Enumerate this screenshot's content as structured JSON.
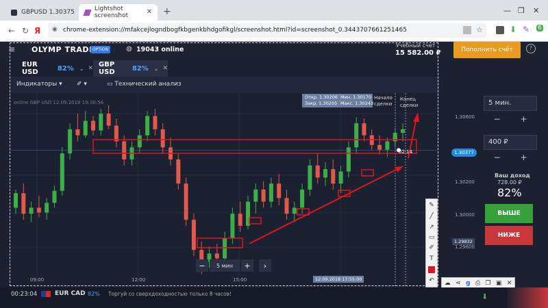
{
  "browser": {
    "tabs": [
      {
        "label": "GBPUSD 1.30375"
      },
      {
        "label": "Lightshot screenshot"
      }
    ],
    "url": "chrome-extension://mfakcejlogndbogfkbgenkbhdgofikgl/screenshot.html?id=screenshot_0.3443707661251465",
    "ext_badge": "6"
  },
  "app": {
    "logo": "OLYMP TRADE",
    "logo_badge": "OPTION",
    "online": "19043 online",
    "account_label": "Учебный счет",
    "account_value": "15 582.00 ₽",
    "topup": "Пополнить счёт",
    "help": "?"
  },
  "assets": [
    {
      "name": "EUR USD",
      "pct": "82%"
    },
    {
      "name": "GBP USD",
      "pct": "82%"
    }
  ],
  "toolbar": {
    "indicators": "Индикаторы",
    "tech": "Технический анализ"
  },
  "chart": {
    "info": "online GBP USD 12.09.2018 19:36:56",
    "tooltip": {
      "open": "Откр. 1.30206",
      "close": "Закр. 1.30205",
      "min": "Мин. 1.30170",
      "max": "Макс. 1.30243"
    },
    "start_label": "Начало сделки",
    "end_label": "Конец сделки",
    "marker_label": "02:14",
    "price_ticks": [
      {
        "label": "1.30600",
        "y": 1.306
      },
      {
        "label": "1.30200",
        "y": 1.302
      },
      {
        "label": "1.30000",
        "y": 1.3
      },
      {
        "label": "1.29832",
        "y": 1.29832
      },
      {
        "label": "1.29800",
        "y": 1.298
      }
    ],
    "current_price": "1.30377",
    "time_ticks": [
      "09:00",
      "12:00",
      "15:00"
    ],
    "crosshair_time": "12.09.2018 17:55:00",
    "zoom_label": "5 мин"
  },
  "panel": {
    "time": "5 мин.",
    "amount": "400 ₽",
    "income_label": "Ваш доход",
    "income_value": "728.00 ₽",
    "income_pct": "82%",
    "buy": "ВЫШЕ",
    "sell": "НИЖЕ"
  },
  "bottom": {
    "timer": "00:23:04",
    "pair": "EUR CAD",
    "pct": "82%",
    "message": "Торгуй со сверхдоходностью только 8 часов!"
  },
  "colors": {
    "bull": "#3fae49",
    "bear": "#e0594a",
    "annotation": "#e0161e",
    "accent": "#4aa3ff"
  },
  "chart_data": {
    "type": "candlestick",
    "candles": [
      {
        "o": 1.299,
        "h": 1.3005,
        "l": 1.2985,
        "c": 1.3002
      },
      {
        "o": 1.3002,
        "h": 1.301,
        "l": 1.298,
        "c": 1.2985
      },
      {
        "o": 1.2985,
        "h": 1.2995,
        "l": 1.2978,
        "c": 1.299
      },
      {
        "o": 1.299,
        "h": 1.3,
        "l": 1.2982,
        "c": 1.2986
      },
      {
        "o": 1.2986,
        "h": 1.2998,
        "l": 1.298,
        "c": 1.2994
      },
      {
        "o": 1.2994,
        "h": 1.3008,
        "l": 1.299,
        "c": 1.3004
      },
      {
        "o": 1.3004,
        "h": 1.304,
        "l": 1.3,
        "c": 1.3035
      },
      {
        "o": 1.3035,
        "h": 1.306,
        "l": 1.303,
        "c": 1.3055
      },
      {
        "o": 1.3055,
        "h": 1.3068,
        "l": 1.3045,
        "c": 1.305
      },
      {
        "o": 1.305,
        "h": 1.307,
        "l": 1.3048,
        "c": 1.3062
      },
      {
        "o": 1.3062,
        "h": 1.3066,
        "l": 1.305,
        "c": 1.3054
      },
      {
        "o": 1.3054,
        "h": 1.3072,
        "l": 1.305,
        "c": 1.3068
      },
      {
        "o": 1.3068,
        "h": 1.3075,
        "l": 1.3055,
        "c": 1.3058
      },
      {
        "o": 1.3058,
        "h": 1.3064,
        "l": 1.304,
        "c": 1.3045
      },
      {
        "o": 1.3045,
        "h": 1.305,
        "l": 1.3025,
        "c": 1.303
      },
      {
        "o": 1.303,
        "h": 1.3045,
        "l": 1.3025,
        "c": 1.304
      },
      {
        "o": 1.304,
        "h": 1.3055,
        "l": 1.3035,
        "c": 1.305
      },
      {
        "o": 1.305,
        "h": 1.307,
        "l": 1.3045,
        "c": 1.3066
      },
      {
        "o": 1.3066,
        "h": 1.3072,
        "l": 1.305,
        "c": 1.3055
      },
      {
        "o": 1.3055,
        "h": 1.306,
        "l": 1.3035,
        "c": 1.304
      },
      {
        "o": 1.304,
        "h": 1.3048,
        "l": 1.3025,
        "c": 1.303
      },
      {
        "o": 1.303,
        "h": 1.3035,
        "l": 1.3005,
        "c": 1.301
      },
      {
        "o": 1.301,
        "h": 1.3015,
        "l": 1.2975,
        "c": 1.298
      },
      {
        "o": 1.298,
        "h": 1.2985,
        "l": 1.295,
        "c": 1.2955
      },
      {
        "o": 1.2955,
        "h": 1.2962,
        "l": 1.2935,
        "c": 1.2945
      },
      {
        "o": 1.2945,
        "h": 1.2958,
        "l": 1.294,
        "c": 1.2952
      },
      {
        "o": 1.2952,
        "h": 1.296,
        "l": 1.2942,
        "c": 1.2948
      },
      {
        "o": 1.2948,
        "h": 1.297,
        "l": 1.2945,
        "c": 1.2965
      },
      {
        "o": 1.2965,
        "h": 1.299,
        "l": 1.296,
        "c": 1.2985
      },
      {
        "o": 1.2985,
        "h": 1.2995,
        "l": 1.297,
        "c": 1.2975
      },
      {
        "o": 1.2975,
        "h": 1.3,
        "l": 1.2972,
        "c": 1.2995
      },
      {
        "o": 1.2995,
        "h": 1.301,
        "l": 1.2985,
        "c": 1.3005
      },
      {
        "o": 1.3005,
        "h": 1.3012,
        "l": 1.299,
        "c": 1.2995
      },
      {
        "o": 1.2995,
        "h": 1.3015,
        "l": 1.299,
        "c": 1.301
      },
      {
        "o": 1.301,
        "h": 1.3018,
        "l": 1.2992,
        "c": 1.2998
      },
      {
        "o": 1.2998,
        "h": 1.3005,
        "l": 1.298,
        "c": 1.2985
      },
      {
        "o": 1.2985,
        "h": 1.2995,
        "l": 1.2978,
        "c": 1.299
      },
      {
        "o": 1.299,
        "h": 1.301,
        "l": 1.2985,
        "c": 1.3005
      },
      {
        "o": 1.3005,
        "h": 1.303,
        "l": 1.3,
        "c": 1.3025
      },
      {
        "o": 1.3025,
        "h": 1.3035,
        "l": 1.301,
        "c": 1.3015
      },
      {
        "o": 1.3015,
        "h": 1.3028,
        "l": 1.3008,
        "c": 1.3022
      },
      {
        "o": 1.3022,
        "h": 1.303,
        "l": 1.3005,
        "c": 1.301
      },
      {
        "o": 1.301,
        "h": 1.3025,
        "l": 1.3002,
        "c": 1.302
      },
      {
        "o": 1.302,
        "h": 1.3045,
        "l": 1.3015,
        "c": 1.304
      },
      {
        "o": 1.304,
        "h": 1.3065,
        "l": 1.3035,
        "c": 1.306
      },
      {
        "o": 1.306,
        "h": 1.3064,
        "l": 1.3045,
        "c": 1.305
      },
      {
        "o": 1.305,
        "h": 1.3055,
        "l": 1.3038,
        "c": 1.3042
      },
      {
        "o": 1.3042,
        "h": 1.305,
        "l": 1.3034,
        "c": 1.3038
      },
      {
        "o": 1.3038,
        "h": 1.3048,
        "l": 1.3032,
        "c": 1.3045
      },
      {
        "o": 1.3045,
        "h": 1.3056,
        "l": 1.304,
        "c": 1.3052
      },
      {
        "o": 1.3052,
        "h": 1.306,
        "l": 1.3045,
        "c": 1.3055
      }
    ]
  }
}
